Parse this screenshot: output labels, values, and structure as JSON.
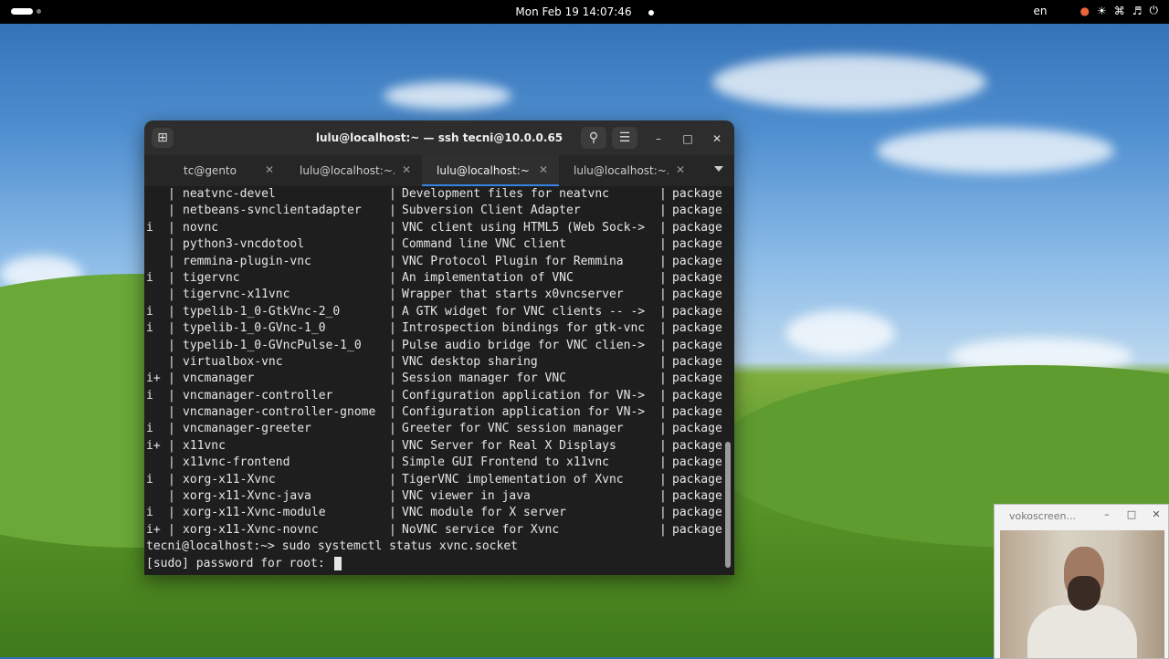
{
  "topbar": {
    "datetime": "Mon Feb 19  14:07:46",
    "language": "en"
  },
  "terminal": {
    "title": "lulu@localhost:~ — ssh tecni@10.0.0.65",
    "tabs": [
      {
        "label": "tc@gento",
        "active": false
      },
      {
        "label": "lulu@localhost:~...",
        "active": false
      },
      {
        "label": "lulu@localhost:~ ...",
        "active": true
      },
      {
        "label": "lulu@localhost:~...",
        "active": false
      }
    ],
    "rows": [
      {
        "flag": "",
        "name": "neatvnc-devel",
        "summary": "Development files for neatvnc",
        "type": "package"
      },
      {
        "flag": "",
        "name": "netbeans-svnclientadapter",
        "summary": "Subversion Client Adapter",
        "type": "package"
      },
      {
        "flag": "i",
        "name": "novnc",
        "summary": "VNC client using HTML5 (Web Sock->",
        "type": "package"
      },
      {
        "flag": "",
        "name": "python3-vncdotool",
        "summary": "Command line VNC client",
        "type": "package"
      },
      {
        "flag": "",
        "name": "remmina-plugin-vnc",
        "summary": "VNC Protocol Plugin for Remmina",
        "type": "package"
      },
      {
        "flag": "i",
        "name": "tigervnc",
        "summary": "An implementation of VNC",
        "type": "package"
      },
      {
        "flag": "",
        "name": "tigervnc-x11vnc",
        "summary": "Wrapper that starts x0vncserver",
        "type": "package"
      },
      {
        "flag": "i",
        "name": "typelib-1_0-GtkVnc-2_0",
        "summary": "A GTK widget for VNC clients -- ->",
        "type": "package"
      },
      {
        "flag": "i",
        "name": "typelib-1_0-GVnc-1_0",
        "summary": "Introspection bindings for gtk-vnc",
        "type": "package"
      },
      {
        "flag": "",
        "name": "typelib-1_0-GVncPulse-1_0",
        "summary": "Pulse audio bridge for VNC clien->",
        "type": "package"
      },
      {
        "flag": "",
        "name": "virtualbox-vnc",
        "summary": "VNC desktop sharing",
        "type": "package"
      },
      {
        "flag": "i+",
        "name": "vncmanager",
        "summary": "Session manager for VNC",
        "type": "package"
      },
      {
        "flag": "i",
        "name": "vncmanager-controller",
        "summary": "Configuration application for VN->",
        "type": "package"
      },
      {
        "flag": "",
        "name": "vncmanager-controller-gnome",
        "summary": "Configuration application for VN->",
        "type": "package"
      },
      {
        "flag": "i",
        "name": "vncmanager-greeter",
        "summary": "Greeter for VNC session manager",
        "type": "package"
      },
      {
        "flag": "i+",
        "name": "x11vnc",
        "summary": "VNC Server for Real X Displays",
        "type": "package"
      },
      {
        "flag": "",
        "name": "x11vnc-frontend",
        "summary": "Simple GUI Frontend to x11vnc",
        "type": "package"
      },
      {
        "flag": "i",
        "name": "xorg-x11-Xvnc",
        "summary": "TigerVNC implementation of Xvnc",
        "type": "package"
      },
      {
        "flag": "",
        "name": "xorg-x11-Xvnc-java",
        "summary": "VNC viewer in java",
        "type": "package"
      },
      {
        "flag": "i",
        "name": "xorg-x11-Xvnc-module",
        "summary": "VNC module for X server",
        "type": "package"
      },
      {
        "flag": "i+",
        "name": "xorg-x11-Xvnc-novnc",
        "summary": "NoVNC service for Xvnc",
        "type": "package"
      }
    ],
    "command_line": "tecni@localhost:~> sudo systemctl status xvnc.socket",
    "password_prompt": "[sudo] password for root: "
  },
  "webcam": {
    "title": "vokoscreen..."
  }
}
